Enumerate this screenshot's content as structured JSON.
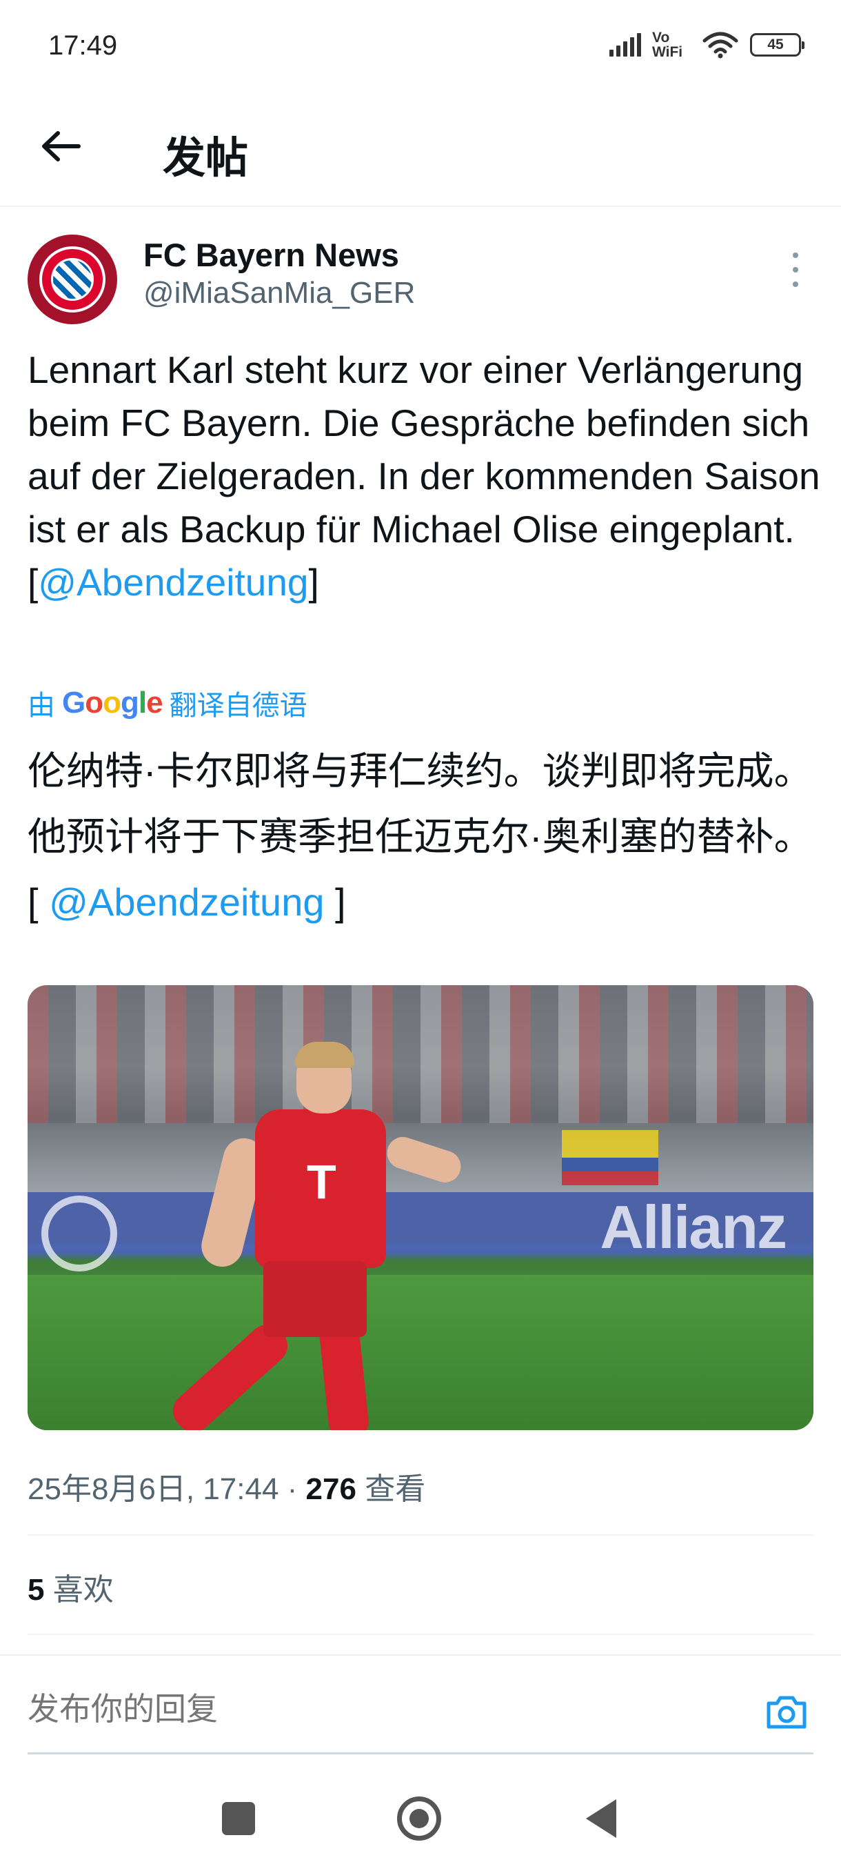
{
  "status_bar": {
    "time": "17:49",
    "network": "Vo WiFi",
    "battery": "45"
  },
  "header": {
    "back_icon": "arrow-left-icon",
    "title": "发帖"
  },
  "tweet": {
    "author_name": "FC Bayern News",
    "author_handle": "@iMiaSanMia_GER",
    "text_before_mention": "Lennart Karl steht kurz vor einer Verlängerung beim FC Bayern. Die Gespräche befinden sich auf der Zielgeraden. In der kommenden Saison ist er als Backup für Michael Olise eingeplant. [",
    "mention": "@Abendzeitung",
    "text_after_mention": "]",
    "translation": {
      "prefix": "由",
      "provider": "Google",
      "suffix": "翻译自德语",
      "text_before_mention": "伦纳特·卡尔即将与拜仁续约。谈判即将完成。他预计将于下赛季担任迈克尔·奥利塞的替补。[ ",
      "mention": "@Abendzeitung",
      "text_after_mention": " ]"
    },
    "media_board_text": "Allianz",
    "timestamp": "25年8月6日, 17:44 · ",
    "views_count": "276",
    "views_label": " 查看",
    "likes_count": "5",
    "likes_label": " 喜欢"
  },
  "reply": {
    "placeholder": "发布你的回复",
    "camera_icon": "camera-icon"
  },
  "colors": {
    "accent": "#1d9bf0",
    "text_primary": "#0f1419",
    "text_secondary": "#536471"
  }
}
